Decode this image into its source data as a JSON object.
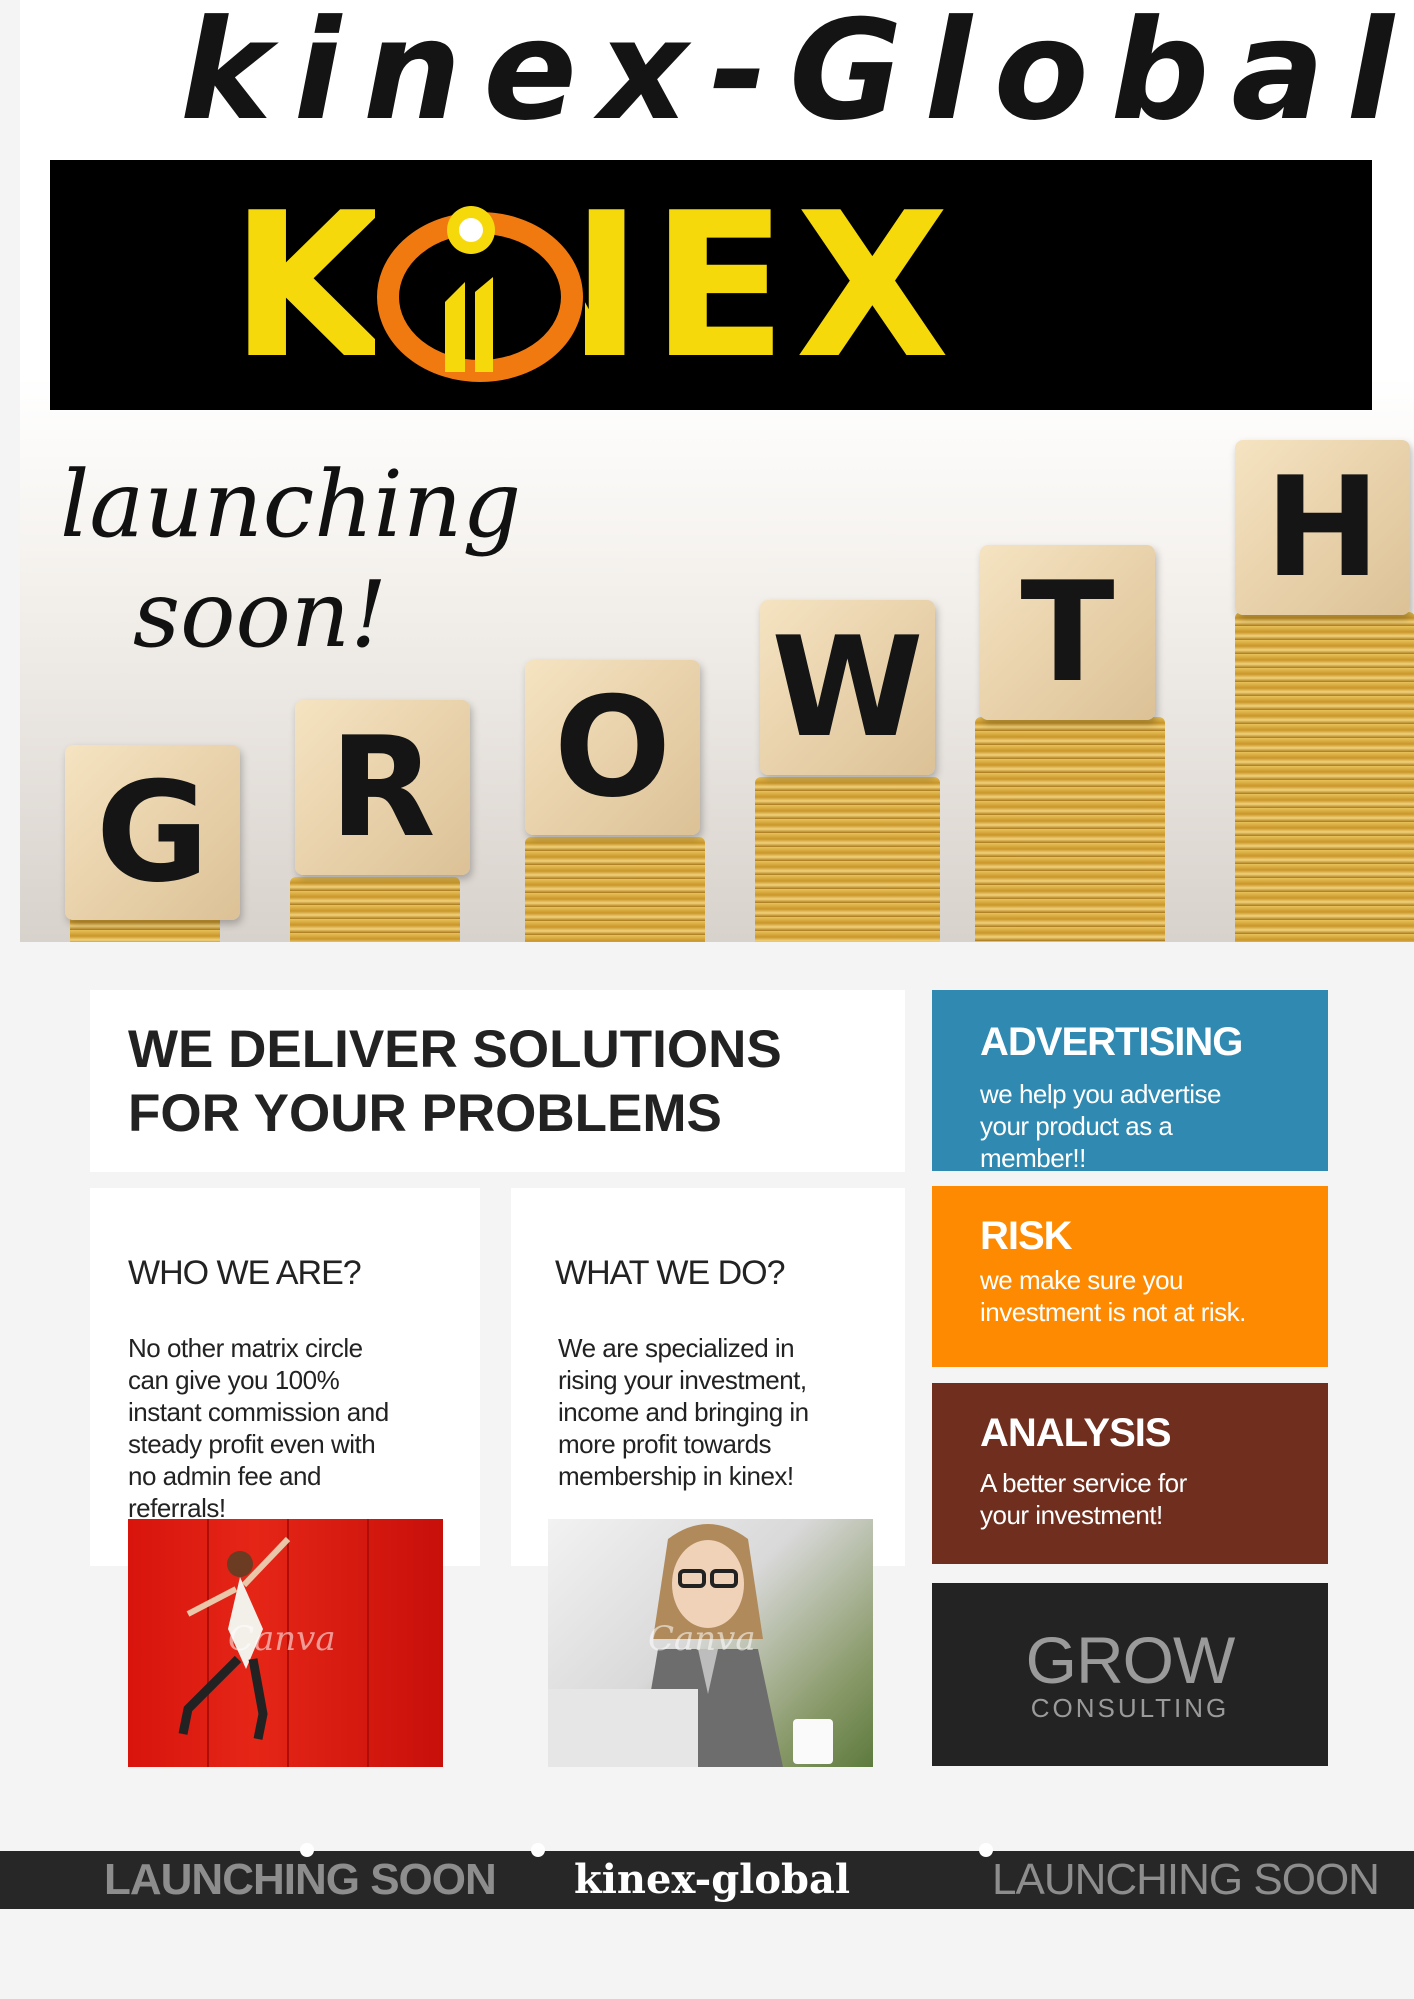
{
  "hero": {
    "brand_title": "kinex-Global",
    "logo_text": "KINEX",
    "script_line1": "launching",
    "script_line2": "soon!",
    "blocks": [
      "G",
      "R",
      "O",
      "W",
      "T",
      "H"
    ]
  },
  "solutions": {
    "title_line1": "WE DELIVER SOLUTIONS",
    "title_line2": "FOR YOUR PROBLEMS"
  },
  "who": {
    "heading": "WHO WE ARE?",
    "body": [
      "No other matrix circle",
      "can give you 100%",
      "instant commission and",
      "steady profit even with",
      "no admin fee and",
      "referrals!"
    ]
  },
  "what": {
    "heading": "WHAT WE DO?",
    "body": [
      "We are specialized in",
      "rising your investment,",
      "income and bringing in",
      "more profit towards",
      "membership in kinex!"
    ]
  },
  "photos": {
    "watermark": "Canva"
  },
  "tiles": {
    "advertising": {
      "title": "ADVERTISING",
      "lines": [
        "we help you advertise",
        "your product as a",
        "member!!"
      ]
    },
    "risk": {
      "title": "RISK",
      "lines": [
        "we make sure you",
        "investment is not at risk."
      ]
    },
    "analysis": {
      "title": "ANALYSIS",
      "lines": [
        "A better service for",
        "your investment!"
      ]
    },
    "grow": {
      "big": "GROW",
      "small": "CONSULTING"
    }
  },
  "bottom_bar": {
    "left": "LAUNCHING SOON",
    "center": "kinex-global",
    "right": "LAUNCHING SOON"
  },
  "colors": {
    "advertising": "#2f89b0",
    "risk": "#fd8a00",
    "analysis": "#6f2e1e",
    "grow": "#232323",
    "logo_yellow": "#f5d90a",
    "logo_orange": "#f07a10"
  }
}
